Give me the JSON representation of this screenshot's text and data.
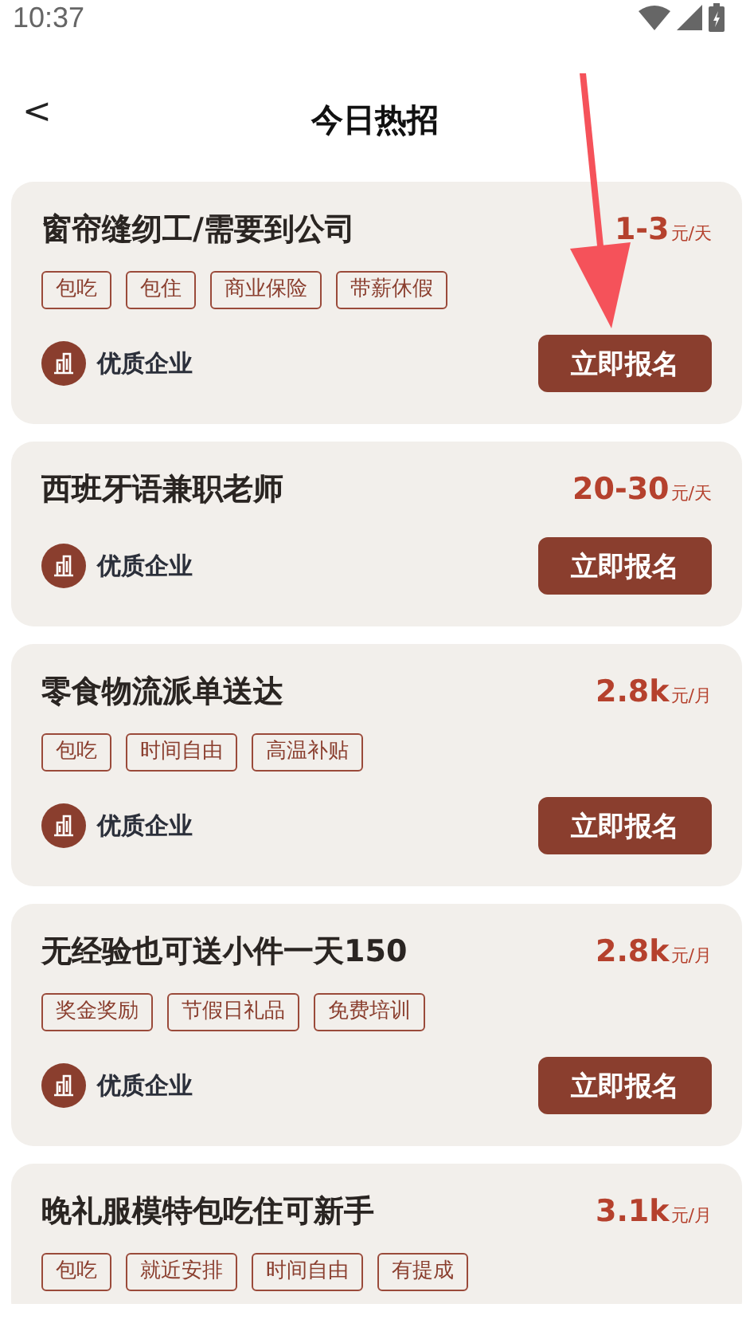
{
  "status_bar": {
    "time": "10:37"
  },
  "header": {
    "back": "<",
    "title": "今日热招"
  },
  "jobs": [
    {
      "title": "窗帘缝纫工/需要到公司",
      "salary": {
        "amount": "1-3",
        "unit": "元/天"
      },
      "tags": [
        "包吃",
        "包住",
        "商业保险",
        "带薪休假"
      ],
      "company": "优质企业",
      "button": "立即报名"
    },
    {
      "title": "西班牙语兼职老师",
      "salary": {
        "amount": "20-30",
        "unit": "元/天"
      },
      "company": "优质企业",
      "button": "立即报名"
    },
    {
      "title": "零食物流派单送达",
      "salary": {
        "amount": "2.8k",
        "unit": "元/月"
      },
      "tags": [
        "包吃",
        "时间自由",
        "高温补贴"
      ],
      "company": "优质企业",
      "button": "立即报名"
    },
    {
      "title": "无经验也可送小件一天150",
      "salary": {
        "amount": "2.8k",
        "unit": "元/月"
      },
      "tags": [
        "奖金奖励",
        "节假日礼品",
        "免费培训"
      ],
      "company": "优质企业",
      "button": "立即报名"
    },
    {
      "title": "晚礼服模特包吃住可新手",
      "salary": {
        "amount": "3.1k",
        "unit": "元/月"
      },
      "tags": [
        "包吃",
        "就近安排",
        "时间自由",
        "有提成"
      ]
    }
  ]
}
